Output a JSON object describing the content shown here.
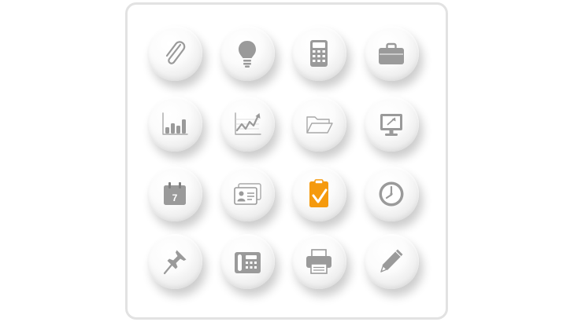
{
  "calendar_icon": {
    "day": "7"
  },
  "colors": {
    "icon_gray": "#9a9a9a",
    "accent_orange": "#f59a0e",
    "panel_border": "#e2e2e2"
  },
  "icons": [
    "paperclip-icon",
    "lightbulb-icon",
    "calculator-icon",
    "briefcase-icon",
    "bar-chart-icon",
    "line-chart-icon",
    "folder-icon",
    "monitor-icon",
    "calendar-icon",
    "contact-cards-icon",
    "checklist-icon",
    "clock-icon",
    "pushpin-icon",
    "fax-phone-icon",
    "printer-icon",
    "pencil-icon"
  ]
}
